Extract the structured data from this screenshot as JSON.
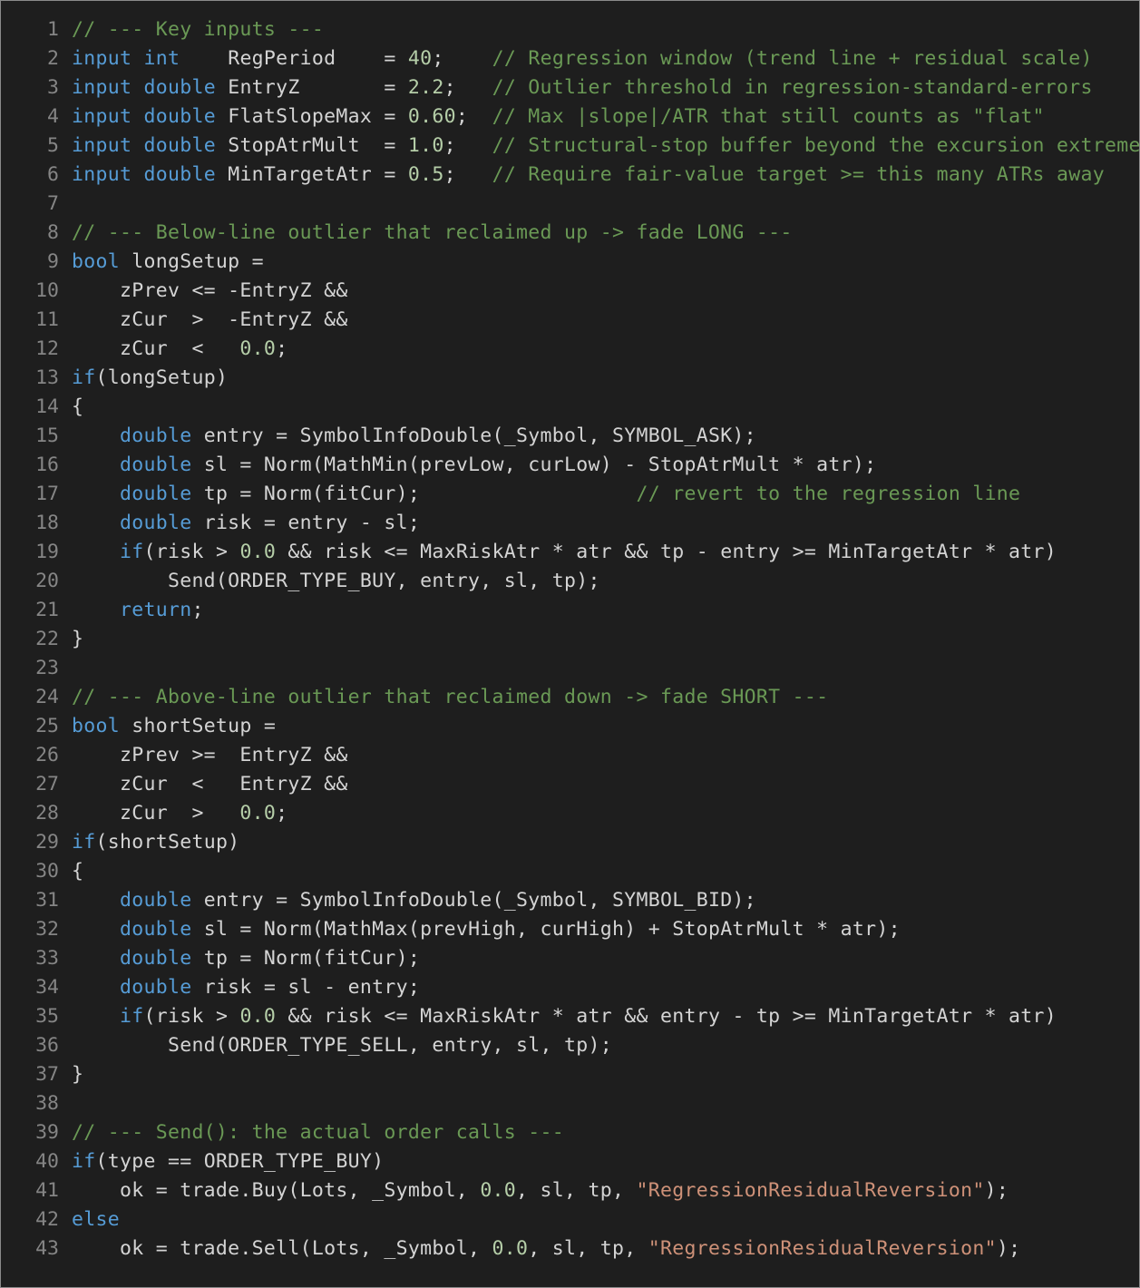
{
  "colors": {
    "background": "#1e1e1e",
    "line_number": "#858585",
    "plain": "#d4d4d4",
    "keyword": "#569cd6",
    "comment": "#6a9955",
    "number": "#b5cea8",
    "string": "#ce9178"
  },
  "lines": [
    {
      "n": "1",
      "tokens": [
        [
          "cm",
          "// --- Key inputs ---"
        ]
      ]
    },
    {
      "n": "2",
      "tokens": [
        [
          "kw",
          "input"
        ],
        [
          "tx",
          " "
        ],
        [
          "kw",
          "int"
        ],
        [
          "tx",
          "    RegPeriod    = "
        ],
        [
          "num",
          "40"
        ],
        [
          "tx",
          ";    "
        ],
        [
          "cm",
          "// Regression window (trend line + residual scale)"
        ]
      ]
    },
    {
      "n": "3",
      "tokens": [
        [
          "kw",
          "input"
        ],
        [
          "tx",
          " "
        ],
        [
          "kw",
          "double"
        ],
        [
          "tx",
          " EntryZ       = "
        ],
        [
          "num",
          "2.2"
        ],
        [
          "tx",
          ";   "
        ],
        [
          "cm",
          "// Outlier threshold in regression-standard-errors"
        ]
      ]
    },
    {
      "n": "4",
      "tokens": [
        [
          "kw",
          "input"
        ],
        [
          "tx",
          " "
        ],
        [
          "kw",
          "double"
        ],
        [
          "tx",
          " FlatSlopeMax = "
        ],
        [
          "num",
          "0.60"
        ],
        [
          "tx",
          ";  "
        ],
        [
          "cm",
          "// Max |slope|/ATR that still counts as \"flat\""
        ]
      ]
    },
    {
      "n": "5",
      "tokens": [
        [
          "kw",
          "input"
        ],
        [
          "tx",
          " "
        ],
        [
          "kw",
          "double"
        ],
        [
          "tx",
          " StopAtrMult  = "
        ],
        [
          "num",
          "1.0"
        ],
        [
          "tx",
          ";   "
        ],
        [
          "cm",
          "// Structural-stop buffer beyond the excursion extreme"
        ]
      ]
    },
    {
      "n": "6",
      "tokens": [
        [
          "kw",
          "input"
        ],
        [
          "tx",
          " "
        ],
        [
          "kw",
          "double"
        ],
        [
          "tx",
          " MinTargetAtr = "
        ],
        [
          "num",
          "0.5"
        ],
        [
          "tx",
          ";   "
        ],
        [
          "cm",
          "// Require fair-value target >= this many ATRs away"
        ]
      ]
    },
    {
      "n": "7",
      "tokens": []
    },
    {
      "n": "8",
      "tokens": [
        [
          "cm",
          "// --- Below-line outlier that reclaimed up -> fade LONG ---"
        ]
      ]
    },
    {
      "n": "9",
      "tokens": [
        [
          "kw",
          "bool"
        ],
        [
          "tx",
          " longSetup ="
        ]
      ]
    },
    {
      "n": "10",
      "tokens": [
        [
          "tx",
          "    zPrev <= -EntryZ &&"
        ]
      ]
    },
    {
      "n": "11",
      "tokens": [
        [
          "tx",
          "    zCur  >  -EntryZ &&"
        ]
      ]
    },
    {
      "n": "12",
      "tokens": [
        [
          "tx",
          "    zCur  <   "
        ],
        [
          "num",
          "0.0"
        ],
        [
          "tx",
          ";"
        ]
      ]
    },
    {
      "n": "13",
      "tokens": [
        [
          "kw",
          "if"
        ],
        [
          "tx",
          "(longSetup)"
        ]
      ]
    },
    {
      "n": "14",
      "tokens": [
        [
          "tx",
          "{"
        ]
      ]
    },
    {
      "n": "15",
      "tokens": [
        [
          "tx",
          "    "
        ],
        [
          "kw",
          "double"
        ],
        [
          "tx",
          " entry = SymbolInfoDouble(_Symbol, SYMBOL_ASK);"
        ]
      ]
    },
    {
      "n": "16",
      "tokens": [
        [
          "tx",
          "    "
        ],
        [
          "kw",
          "double"
        ],
        [
          "tx",
          " sl = Norm(MathMin(prevLow, curLow) - StopAtrMult * atr);"
        ]
      ]
    },
    {
      "n": "17",
      "tokens": [
        [
          "tx",
          "    "
        ],
        [
          "kw",
          "double"
        ],
        [
          "tx",
          " tp = Norm(fitCur);                  "
        ],
        [
          "cm",
          "// revert to the regression line"
        ]
      ]
    },
    {
      "n": "18",
      "tokens": [
        [
          "tx",
          "    "
        ],
        [
          "kw",
          "double"
        ],
        [
          "tx",
          " risk = entry - sl;"
        ]
      ]
    },
    {
      "n": "19",
      "tokens": [
        [
          "tx",
          "    "
        ],
        [
          "kw",
          "if"
        ],
        [
          "tx",
          "(risk > "
        ],
        [
          "num",
          "0.0"
        ],
        [
          "tx",
          " && risk <= MaxRiskAtr * atr && tp - entry >= MinTargetAtr * atr)"
        ]
      ]
    },
    {
      "n": "20",
      "tokens": [
        [
          "tx",
          "        Send(ORDER_TYPE_BUY, entry, sl, tp);"
        ]
      ]
    },
    {
      "n": "21",
      "tokens": [
        [
          "tx",
          "    "
        ],
        [
          "kw",
          "return"
        ],
        [
          "tx",
          ";"
        ]
      ]
    },
    {
      "n": "22",
      "tokens": [
        [
          "tx",
          "}"
        ]
      ]
    },
    {
      "n": "23",
      "tokens": []
    },
    {
      "n": "24",
      "tokens": [
        [
          "cm",
          "// --- Above-line outlier that reclaimed down -> fade SHORT ---"
        ]
      ]
    },
    {
      "n": "25",
      "tokens": [
        [
          "kw",
          "bool"
        ],
        [
          "tx",
          " shortSetup ="
        ]
      ]
    },
    {
      "n": "26",
      "tokens": [
        [
          "tx",
          "    zPrev >=  EntryZ &&"
        ]
      ]
    },
    {
      "n": "27",
      "tokens": [
        [
          "tx",
          "    zCur  <   EntryZ &&"
        ]
      ]
    },
    {
      "n": "28",
      "tokens": [
        [
          "tx",
          "    zCur  >   "
        ],
        [
          "num",
          "0.0"
        ],
        [
          "tx",
          ";"
        ]
      ]
    },
    {
      "n": "29",
      "tokens": [
        [
          "kw",
          "if"
        ],
        [
          "tx",
          "(shortSetup)"
        ]
      ]
    },
    {
      "n": "30",
      "tokens": [
        [
          "tx",
          "{"
        ]
      ]
    },
    {
      "n": "31",
      "tokens": [
        [
          "tx",
          "    "
        ],
        [
          "kw",
          "double"
        ],
        [
          "tx",
          " entry = SymbolInfoDouble(_Symbol, SYMBOL_BID);"
        ]
      ]
    },
    {
      "n": "32",
      "tokens": [
        [
          "tx",
          "    "
        ],
        [
          "kw",
          "double"
        ],
        [
          "tx",
          " sl = Norm(MathMax(prevHigh, curHigh) + StopAtrMult * atr);"
        ]
      ]
    },
    {
      "n": "33",
      "tokens": [
        [
          "tx",
          "    "
        ],
        [
          "kw",
          "double"
        ],
        [
          "tx",
          " tp = Norm(fitCur);"
        ]
      ]
    },
    {
      "n": "34",
      "tokens": [
        [
          "tx",
          "    "
        ],
        [
          "kw",
          "double"
        ],
        [
          "tx",
          " risk = sl - entry;"
        ]
      ]
    },
    {
      "n": "35",
      "tokens": [
        [
          "tx",
          "    "
        ],
        [
          "kw",
          "if"
        ],
        [
          "tx",
          "(risk > "
        ],
        [
          "num",
          "0.0"
        ],
        [
          "tx",
          " && risk <= MaxRiskAtr * atr && entry - tp >= MinTargetAtr * atr)"
        ]
      ]
    },
    {
      "n": "36",
      "tokens": [
        [
          "tx",
          "        Send(ORDER_TYPE_SELL, entry, sl, tp);"
        ]
      ]
    },
    {
      "n": "37",
      "tokens": [
        [
          "tx",
          "}"
        ]
      ]
    },
    {
      "n": "38",
      "tokens": []
    },
    {
      "n": "39",
      "tokens": [
        [
          "cm",
          "// --- Send(): the actual order calls ---"
        ]
      ]
    },
    {
      "n": "40",
      "tokens": [
        [
          "kw",
          "if"
        ],
        [
          "tx",
          "(type == ORDER_TYPE_BUY)"
        ]
      ]
    },
    {
      "n": "41",
      "tokens": [
        [
          "tx",
          "    ok = trade.Buy(Lots, _Symbol, "
        ],
        [
          "num",
          "0.0"
        ],
        [
          "tx",
          ", sl, tp, "
        ],
        [
          "str",
          "\"RegressionResidualReversion\""
        ],
        [
          "tx",
          ");"
        ]
      ]
    },
    {
      "n": "42",
      "tokens": [
        [
          "kw",
          "else"
        ]
      ]
    },
    {
      "n": "43",
      "tokens": [
        [
          "tx",
          "    ok = trade.Sell(Lots, _Symbol, "
        ],
        [
          "num",
          "0.0"
        ],
        [
          "tx",
          ", sl, tp, "
        ],
        [
          "str",
          "\"RegressionResidualReversion\""
        ],
        [
          "tx",
          ");"
        ]
      ]
    }
  ]
}
